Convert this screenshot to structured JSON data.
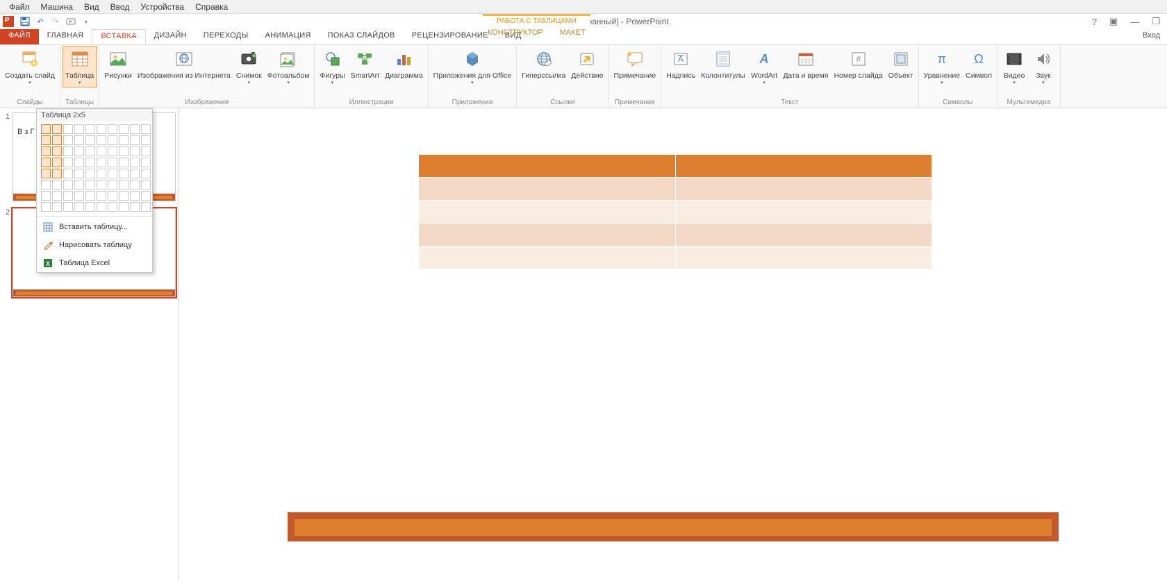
{
  "vm_menu": [
    "Файл",
    "Машина",
    "Вид",
    "Ввод",
    "Устройства",
    "Справка"
  ],
  "title": "pptE87D.pptm [Автосохранный] - PowerPoint",
  "sign_in": "Вход",
  "tabs": {
    "file": "ФАЙЛ",
    "items": [
      "ГЛАВНАЯ",
      "ВСТАВКА",
      "ДИЗАЙН",
      "ПЕРЕХОДЫ",
      "АНИМАЦИЯ",
      "ПОКАЗ СЛАЙДОВ",
      "РЕЦЕНЗИРОВАНИЕ",
      "ВИД"
    ],
    "active_index": 1,
    "context_label": "РАБОТА С ТАБЛИЦАМИ",
    "context_items": [
      "КОНСТРУКТОР",
      "МАКЕТ"
    ]
  },
  "ribbon": {
    "groups": [
      {
        "label": "Слайды",
        "items": [
          {
            "name": "Создать слайд",
            "icon": "new-slide",
            "arrow": true
          }
        ]
      },
      {
        "label": "Таблицы",
        "items": [
          {
            "name": "Таблица",
            "icon": "table",
            "arrow": true,
            "selected": true
          }
        ]
      },
      {
        "label": "Изображения",
        "items": [
          {
            "name": "Рисунки",
            "icon": "pictures"
          },
          {
            "name": "Изображения из Интернета",
            "icon": "online-pictures"
          },
          {
            "name": "Снимок",
            "icon": "screenshot",
            "arrow": true
          },
          {
            "name": "Фотоальбом",
            "icon": "photo-album",
            "arrow": true
          }
        ]
      },
      {
        "label": "Иллюстрации",
        "items": [
          {
            "name": "Фигуры",
            "icon": "shapes",
            "arrow": true
          },
          {
            "name": "SmartArt",
            "icon": "smartart"
          },
          {
            "name": "Диаграмма",
            "icon": "chart"
          }
        ]
      },
      {
        "label": "Приложения",
        "items": [
          {
            "name": "Приложения для Office",
            "icon": "apps",
            "arrow": true
          }
        ]
      },
      {
        "label": "Ссылки",
        "items": [
          {
            "name": "Гиперссылка",
            "icon": "hyperlink"
          },
          {
            "name": "Действие",
            "icon": "action"
          }
        ]
      },
      {
        "label": "Примечания",
        "items": [
          {
            "name": "Примечание",
            "icon": "comment"
          }
        ]
      },
      {
        "label": "Текст",
        "items": [
          {
            "name": "Надпись",
            "icon": "textbox"
          },
          {
            "name": "Колонтитулы",
            "icon": "header-footer"
          },
          {
            "name": "WordArt",
            "icon": "wordart",
            "arrow": true
          },
          {
            "name": "Дата и время",
            "icon": "date-time"
          },
          {
            "name": "Номер слайда",
            "icon": "slide-number"
          },
          {
            "name": "Объект",
            "icon": "object"
          }
        ]
      },
      {
        "label": "Символы",
        "items": [
          {
            "name": "Уравнение",
            "icon": "equation",
            "arrow": true
          },
          {
            "name": "Символ",
            "icon": "symbol"
          }
        ]
      },
      {
        "label": "Мультимедиа",
        "items": [
          {
            "name": "Видео",
            "icon": "video",
            "arrow": true
          },
          {
            "name": "Звук",
            "icon": "audio",
            "arrow": true
          }
        ]
      }
    ]
  },
  "table_dropdown": {
    "title": "Таблица 2x5",
    "cols": 2,
    "rows": 5,
    "grid_cols": 10,
    "grid_rows": 8,
    "menu": [
      {
        "label": "Вставить таблицу...",
        "icon": "insert-table"
      },
      {
        "label": "Нарисовать таблицу",
        "icon": "draw-table"
      },
      {
        "label": "Таблица Excel",
        "icon": "excel-table"
      }
    ]
  },
  "thumbnails": [
    {
      "num": "1",
      "preview": "В\nз\nГ"
    },
    {
      "num": "2",
      "selected": true
    }
  ]
}
